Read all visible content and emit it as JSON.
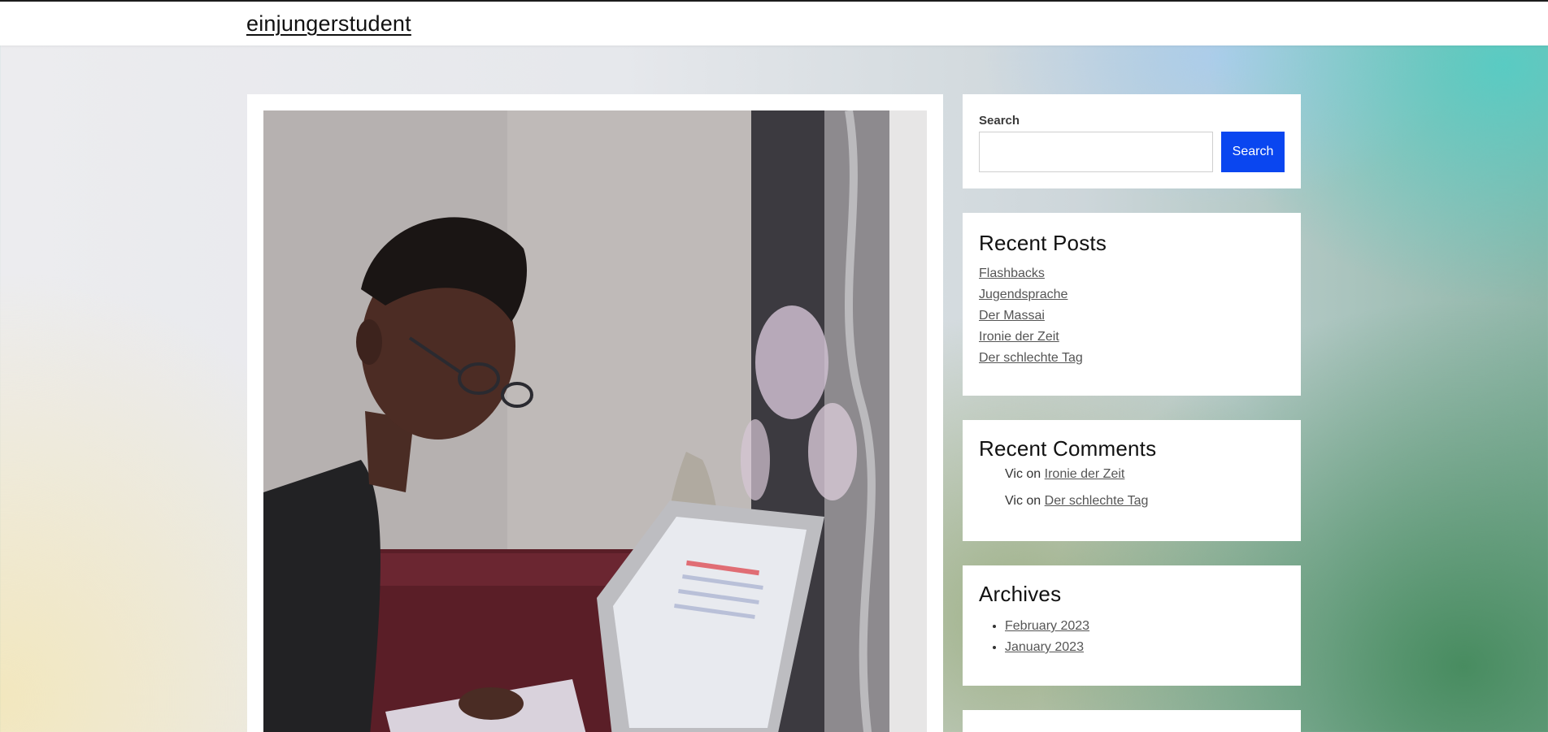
{
  "header": {
    "site_title": "einjungerstudent"
  },
  "main": {
    "featured_image_alt": "Student with glasses reading, laptop in front, curtain in background"
  },
  "sidebar": {
    "search": {
      "label": "Search",
      "input_value": "",
      "button_label": "Search"
    },
    "recent_posts": {
      "title": "Recent Posts",
      "items": [
        "Flashbacks",
        "Jugendsprache",
        "Der Massai",
        "Ironie der Zeit",
        "Der schlechte Tag"
      ]
    },
    "recent_comments": {
      "title": "Recent Comments",
      "items": [
        {
          "author": "Vic",
          "on": "on",
          "post": "Ironie der Zeit"
        },
        {
          "author": "Vic",
          "on": "on",
          "post": "Der schlechte Tag"
        }
      ]
    },
    "archives": {
      "title": "Archives",
      "items": [
        "February 2023",
        "January 2023"
      ]
    }
  },
  "colors": {
    "accent": "#0a46f0",
    "link": "#555555",
    "card": "#ffffff"
  }
}
